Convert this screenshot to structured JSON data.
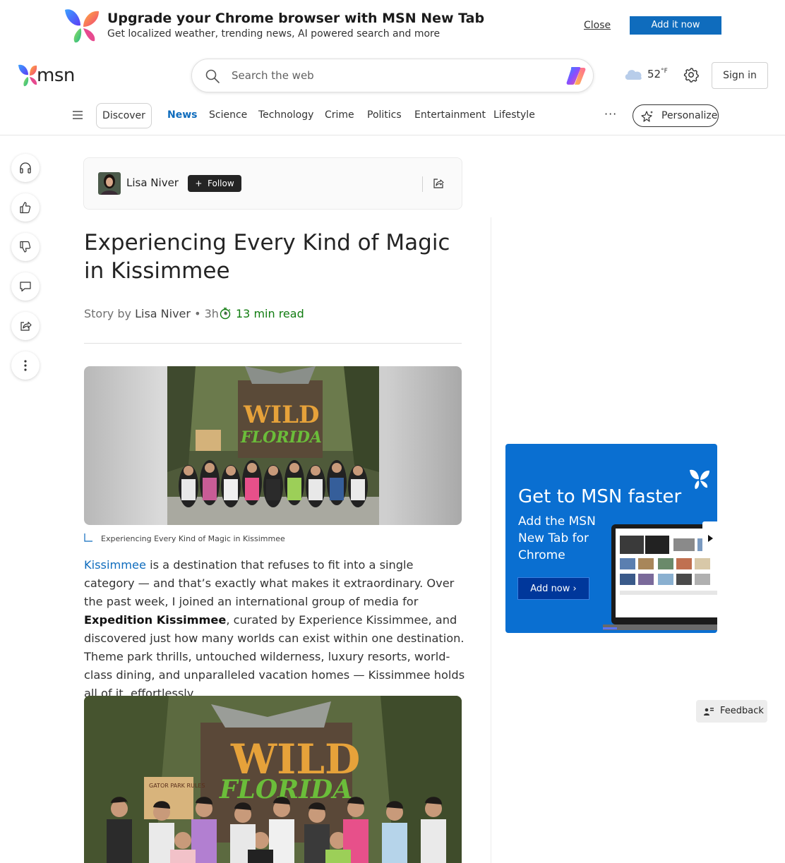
{
  "banner": {
    "title": "Upgrade your Chrome browser with MSN New Tab",
    "subtitle": "Get localized weather, trending news, AI powered search and more",
    "close_label": "Close",
    "add_label": "Add it now"
  },
  "header": {
    "logo_text": "msn",
    "search_placeholder": "Search the web",
    "weather_temp": "52",
    "weather_unit": "°F",
    "signin_label": "Sign in"
  },
  "nav": {
    "discover": "Discover",
    "items": [
      "News",
      "Science",
      "Technology",
      "Crime",
      "Politics",
      "Entertainment",
      "Lifestyle"
    ],
    "active": "News",
    "more": "···",
    "personalize": "Personalize"
  },
  "author": {
    "name": "Lisa Niver",
    "follow_label": "Follow",
    "follow_prefix": "+"
  },
  "article": {
    "headline": "Experiencing Every Kind of Magic in Kissimmee",
    "byline_prefix": "Story by",
    "byline_author": "Lisa Niver",
    "byline_time": "• 3h •",
    "read_time": "13 min read",
    "image_caption": "Experiencing Every Kind of Magic in Kissimmee",
    "body_link": "Kissimmee",
    "body_part1": " is a destination that refuses to fit into a single category — and that’s exactly what makes it extraordinary. Over the past week, I joined an international group of media for ",
    "body_bold": "Expedition Kissimmee",
    "body_part2": ", curated by Experience Kissimmee, and discovered just how many worlds can exist within one destination. Theme park thrills, untouched wilderness, luxury resorts, world-class dining, and unparalleled vacation homes — Kissimmee holds all of it, effortlessly."
  },
  "ad": {
    "title": "Get to MSN faster",
    "subtitle": "Add the MSN New Tab for Chrome",
    "button": "Add now ›"
  },
  "feedback_label": "Feedback",
  "colors": {
    "accent": "#0f6cbd",
    "read_time": "#107c10",
    "ad_bg": "#0a6fd1"
  }
}
